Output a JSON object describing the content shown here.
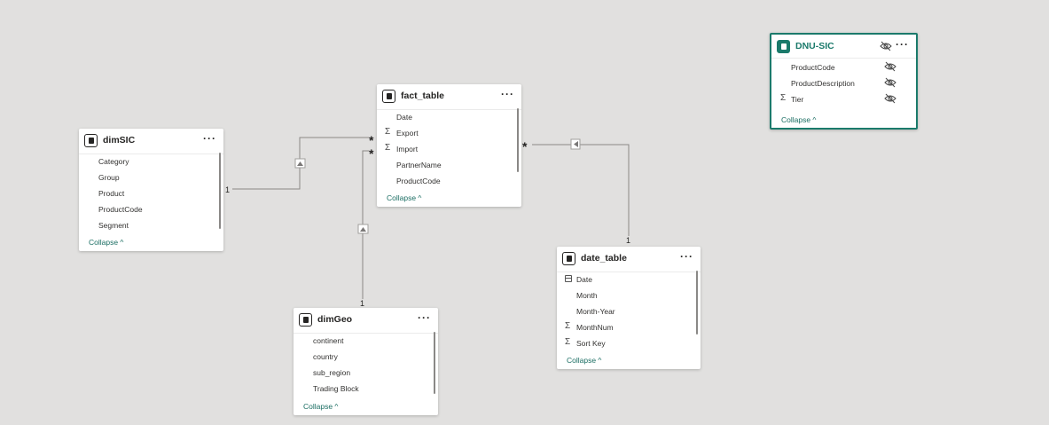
{
  "tables": {
    "dimSIC": {
      "name": "dimSIC",
      "fields": [
        "Category",
        "Group",
        "Product",
        "ProductCode",
        "Segment"
      ],
      "collapse": "Collapse ^"
    },
    "fact_table": {
      "name": "fact_table",
      "fields": [
        {
          "label": "Date",
          "icon": ""
        },
        {
          "label": "Export",
          "icon": "Σ"
        },
        {
          "label": "Import",
          "icon": "Σ"
        },
        {
          "label": "PartnerName",
          "icon": ""
        },
        {
          "label": "ProductCode",
          "icon": ""
        }
      ],
      "collapse": "Collapse ^"
    },
    "dimGeo": {
      "name": "dimGeo",
      "fields": [
        "continent",
        "country",
        "sub_region",
        "Trading Block"
      ],
      "collapse": "Collapse ^"
    },
    "date_table": {
      "name": "date_table",
      "fields": [
        {
          "label": "Date",
          "icon": "calendar"
        },
        {
          "label": "Month",
          "icon": ""
        },
        {
          "label": "Month-Year",
          "icon": ""
        },
        {
          "label": "MonthNum",
          "icon": "Σ"
        },
        {
          "label": "Sort Key",
          "icon": "Σ"
        }
      ],
      "collapse": "Collapse ^"
    },
    "dnu_sic": {
      "name": "DNU-SIC",
      "fields": [
        {
          "label": "ProductCode",
          "icon": ""
        },
        {
          "label": "ProductDescription",
          "icon": ""
        },
        {
          "label": "Tier",
          "icon": "Σ"
        }
      ],
      "collapse": "Collapse ^"
    }
  },
  "more_label": "···",
  "cardinality": {
    "dimSIC_to_fact": {
      "one": "1",
      "many": "*"
    },
    "dimGeo_to_fact": {
      "one": "1",
      "many": "*"
    },
    "date_to_fact": {
      "one": "1",
      "many": "*"
    }
  },
  "colors": {
    "accent": "#1b7a6b",
    "canvas": "#e1e0df",
    "line": "#8a8886"
  }
}
